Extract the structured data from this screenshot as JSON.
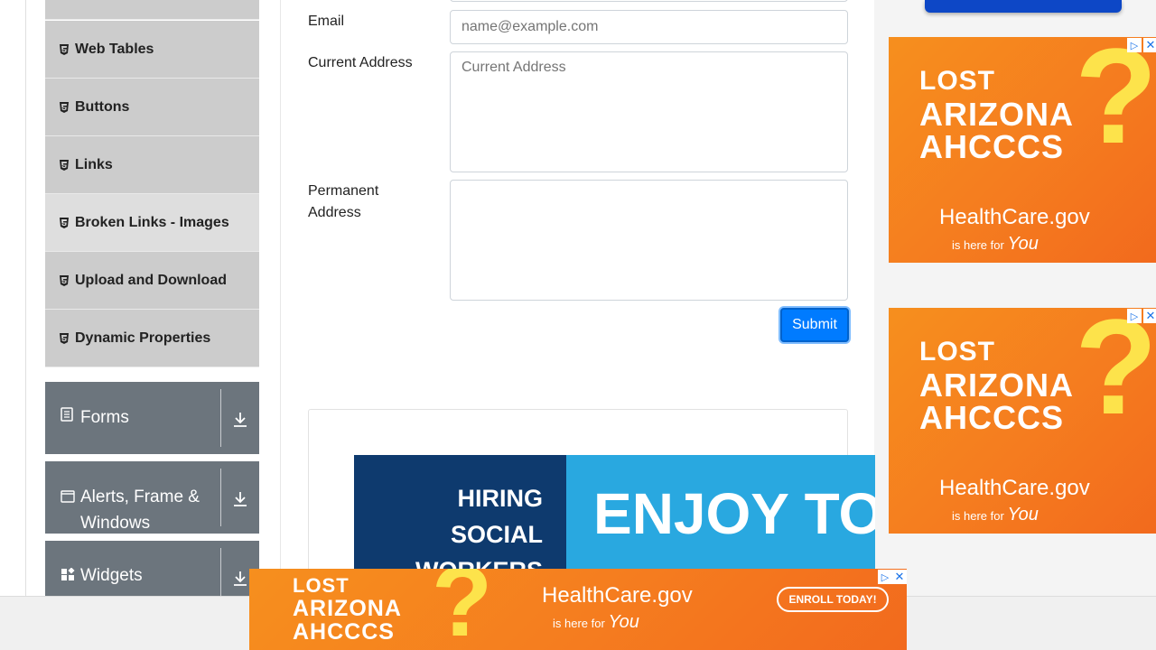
{
  "sidebar": {
    "menu_items": [
      {
        "label": "Web Tables"
      },
      {
        "label": "Buttons"
      },
      {
        "label": "Links"
      },
      {
        "label": "Broken Links - Images"
      },
      {
        "label": "Upload and Download"
      },
      {
        "label": "Dynamic Properties"
      }
    ],
    "groups": [
      {
        "label": "Forms",
        "icon": "form-icon"
      },
      {
        "label": "Alerts, Frame & Windows",
        "icon": "window-icon"
      },
      {
        "label": "Widgets",
        "icon": "widgets-icon"
      }
    ]
  },
  "form": {
    "email_label": "Email",
    "email_placeholder": "name@example.com",
    "current_address_label": "Current Address",
    "current_address_placeholder": "Current Address",
    "permanent_address_label": "Permanent Address",
    "submit_label": "Submit"
  },
  "ads": {
    "az_line1": "LOST",
    "az_line2": "ARIZONA",
    "az_line3": "AHCCCS",
    "hc_title": "HealthCare.gov",
    "hc_sub_1": "is here for",
    "hc_sub_2": "You",
    "enroll": "ENROLL TODAY!",
    "hiring_line1": "HIRING",
    "hiring_line2": "SOCIAL",
    "hiring_line3": "WORKERS",
    "enjoy": "ENJOY TO",
    "close_symbol": "✕",
    "adchoices_symbol": "▷"
  },
  "colors": {
    "menu_bg": "#cccccc",
    "group_bg": "#6c757d",
    "primary": "#007bff",
    "ad_orange": "#f57c1f"
  }
}
